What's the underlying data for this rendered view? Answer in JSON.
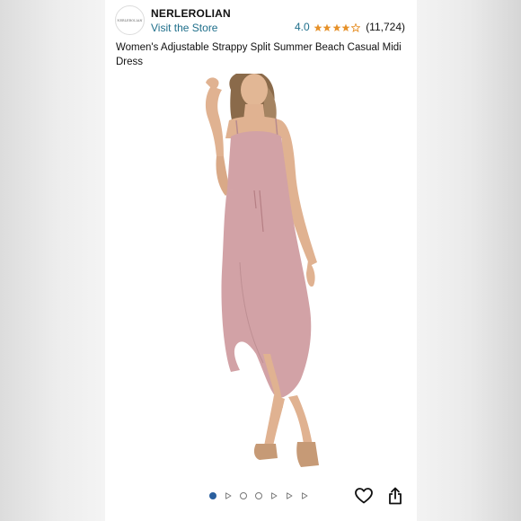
{
  "seller": {
    "logo_text": "NERLEROLIAN",
    "name": "NERLEROLIAN",
    "visit_store": "Visit the Store"
  },
  "rating": {
    "value": "4.0",
    "stars": 4,
    "max_stars": 5,
    "count": "(11,724)"
  },
  "product": {
    "title": "Women's Adjustable Strappy Split Summer Beach Casual Midi Dress",
    "dress_color": "#d2a2a6"
  },
  "gallery": {
    "images": [
      {
        "kind": "image",
        "active": true
      },
      {
        "kind": "video"
      },
      {
        "kind": "image"
      },
      {
        "kind": "image"
      },
      {
        "kind": "video"
      },
      {
        "kind": "video"
      },
      {
        "kind": "video"
      }
    ]
  },
  "actions": {
    "wishlist_icon": "heart-icon",
    "share_icon": "share-icon"
  },
  "colors": {
    "link": "#1f6f8b",
    "star": "#e6912a",
    "active_dot": "#2a5f9e"
  }
}
